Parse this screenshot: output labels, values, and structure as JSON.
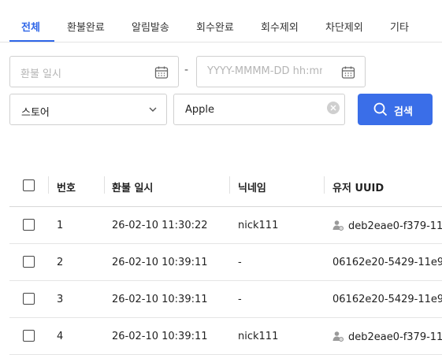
{
  "tabs": [
    {
      "label": "전체",
      "active": true
    },
    {
      "label": "환불완료"
    },
    {
      "label": "알림발송"
    },
    {
      "label": "회수완료"
    },
    {
      "label": "회수제외"
    },
    {
      "label": "차단제외"
    },
    {
      "label": "기타"
    }
  ],
  "filters": {
    "date_start_placeholder": "환불 일시",
    "date_separator": "-",
    "date_end_placeholder": "YYYY-MMMM-DD hh:mm",
    "store_select": "스토어",
    "platform_select": "Apple",
    "search_button": "검색"
  },
  "table": {
    "headers": {
      "number": "번호",
      "refund_time": "환불 일시",
      "nickname": "닉네임",
      "user_uuid": "유저 UUID"
    },
    "rows": [
      {
        "number": "1",
        "refund_time": "26-02-10 11:30:22",
        "nickname": "nick111",
        "user_uuid": "deb2eae0-f379-11",
        "user_icon": "user-settings-icon"
      },
      {
        "number": "2",
        "refund_time": "26-02-10 10:39:11",
        "nickname": "-",
        "user_uuid": "06162e20-5429-11e9"
      },
      {
        "number": "3",
        "refund_time": "26-02-10 10:39:11",
        "nickname": "-",
        "user_uuid": "06162e20-5429-11e9"
      },
      {
        "number": "4",
        "refund_time": "26-02-10 10:39:11",
        "nickname": "nick111",
        "user_uuid": "deb2eae0-f379-11",
        "user_icon": "user-settings-icon"
      }
    ]
  },
  "colors": {
    "accent": "#2f66e8",
    "button": "#3a6ee8"
  }
}
